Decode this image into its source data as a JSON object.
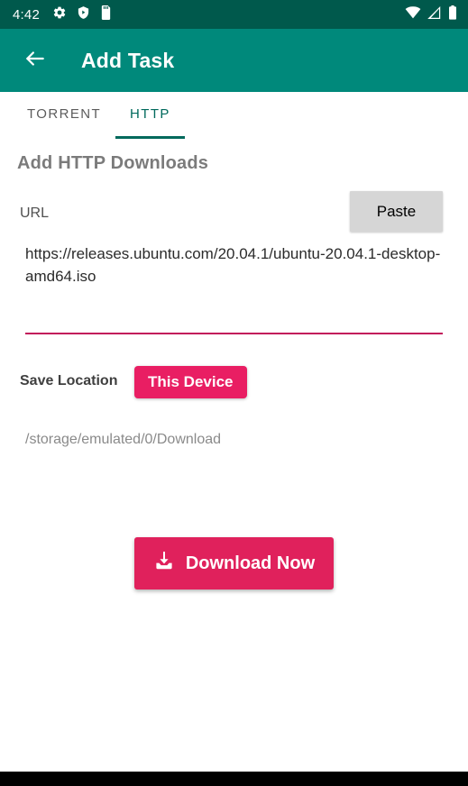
{
  "statusbar": {
    "time": "4:42",
    "left_icons": [
      "gear-icon",
      "shield-play-icon",
      "sd-card-icon"
    ],
    "right_icons": [
      "wifi-icon",
      "cell-signal-icon",
      "battery-icon"
    ],
    "background": "#00594C"
  },
  "appbar": {
    "back_icon": "back-arrow-icon",
    "title": "Add Task",
    "background": "#00897B"
  },
  "tabs": [
    {
      "label": "TORRENT",
      "active": false
    },
    {
      "label": "HTTP",
      "active": true
    }
  ],
  "main": {
    "heading": "Add HTTP Downloads",
    "url_label": "URL",
    "paste_label": "Paste",
    "url_value": "https://releases.ubuntu.com/20.04.1/ubuntu-20.04.1-desktop-amd64.iso",
    "save_location_label": "Save Location",
    "save_location_value": "This Device",
    "save_path": "/storage/emulated/0/Download",
    "download_label": "Download Now",
    "download_icon": "download-icon",
    "accent_pink": "#E91E63",
    "accent_teal": "#00695C",
    "underline_color": "#C2185B"
  }
}
